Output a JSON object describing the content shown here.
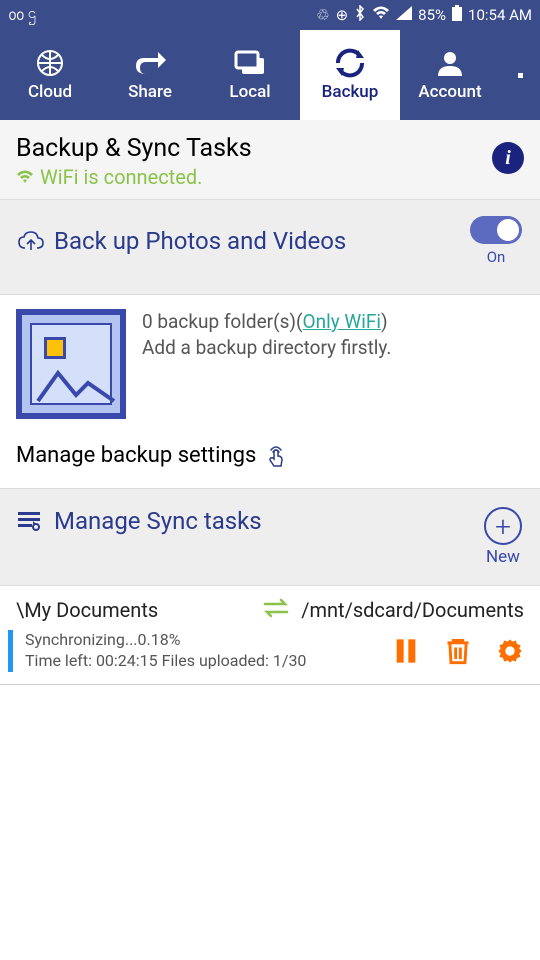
{
  "status": {
    "battery": "85%",
    "time": "10:54 AM"
  },
  "tabs": {
    "cloud": "Cloud",
    "share": "Share",
    "local": "Local",
    "backup": "Backup",
    "account": "Account"
  },
  "header": {
    "title": "Backup & Sync Tasks",
    "wifi": "WiFi is connected."
  },
  "backup": {
    "title": "Back up Photos and Videos",
    "toggle_state": "On",
    "folder_count_prefix": "0 backup folder(s)(",
    "folder_count_link": "Only WiFi",
    "folder_count_suffix": ")",
    "hint": "Add a backup directory firstly.",
    "manage": "Manage backup settings"
  },
  "sync": {
    "title": "Manage Sync tasks",
    "new": "New"
  },
  "task": {
    "src": "\\My Documents",
    "dst": "/mnt/sdcard/Documents",
    "line1": "Synchronizing...0.18%",
    "line2": "Time left: 00:24:15  Files uploaded:  1/30"
  }
}
